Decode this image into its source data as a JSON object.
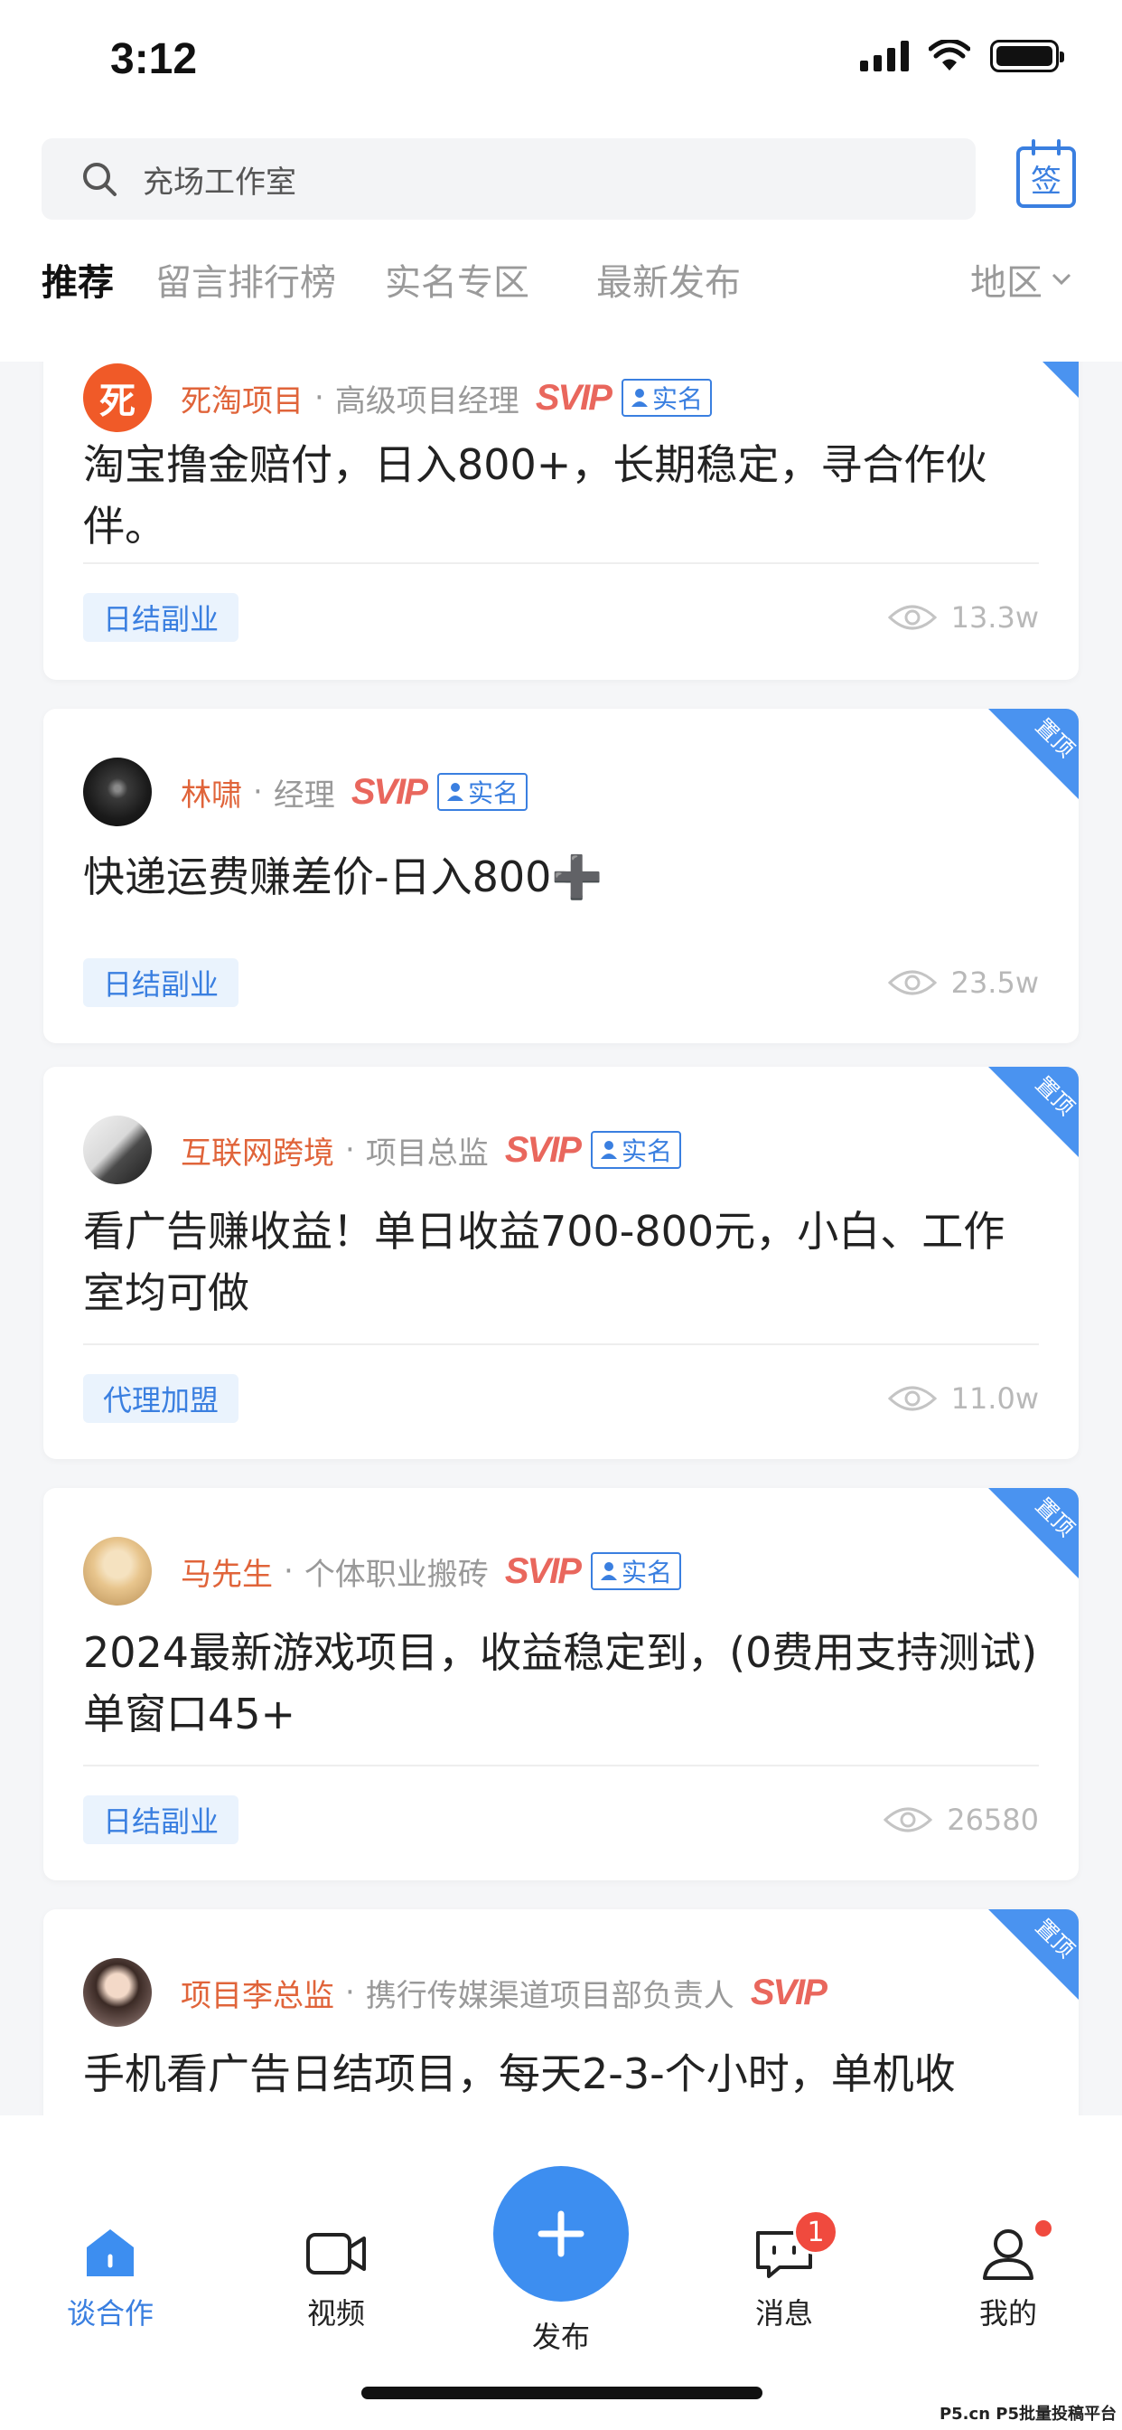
{
  "status_bar": {
    "time": "3:12"
  },
  "search": {
    "text": "充场工作室"
  },
  "checkin": {
    "label": "签"
  },
  "tabs": [
    {
      "label": "推荐",
      "active": true
    },
    {
      "label": "留言排行榜",
      "active": false
    },
    {
      "label": "实名专区",
      "active": false
    },
    {
      "label": "最新发布",
      "active": false
    }
  ],
  "region": {
    "label": "地区"
  },
  "svip_label": "SVIP",
  "verified_label": "实名",
  "pin_label": "置顶",
  "posts": [
    {
      "author": "死淘项目",
      "role": "高级项目经理",
      "svip": true,
      "verified": true,
      "pinned": true,
      "title": "淘宝撸金赔付，日入800+，长期稳定，寻合作伙伴。",
      "tag": "日结副业",
      "views": "13.3w",
      "avatar_label": "死"
    },
    {
      "author": "林啸",
      "role": "经理",
      "svip": true,
      "verified": true,
      "pinned": true,
      "title": "快递运费赚差价-日入800➕",
      "tag": "日结副业",
      "views": "23.5w"
    },
    {
      "author": "互联网跨境",
      "role": "项目总监",
      "svip": true,
      "verified": true,
      "pinned": true,
      "title": "看广告赚收益！单日收益700-800元，小白、工作室均可做",
      "tag": "代理加盟",
      "views": "11.0w"
    },
    {
      "author": "马先生",
      "role": "个体职业搬砖",
      "svip": true,
      "verified": true,
      "pinned": true,
      "title": "2024最新游戏项目，收益稳定到，(0费用支持测试)单窗口45+",
      "tag": "日结副业",
      "views": "26580"
    },
    {
      "author": "项目李总监",
      "role": "携行传媒渠道项目部负责人",
      "svip": true,
      "verified": false,
      "pinned": true,
      "title": "手机看广告日结项目，每天2-3-个小时，单机收",
      "tag": "",
      "views": ""
    }
  ],
  "bottom_nav": {
    "items": [
      {
        "label": "谈合作",
        "active": true
      },
      {
        "label": "视频",
        "active": false
      },
      {
        "label": "发布",
        "active": false
      },
      {
        "label": "消息",
        "active": false,
        "badge": "1"
      },
      {
        "label": "我的",
        "active": false
      }
    ]
  },
  "watermark": "P5.cn P5批量投稿平台",
  "colors": {
    "accent": "#3a7fe0",
    "author": "#e0643a",
    "svip": "#e9675d",
    "badge": "#f04a3e"
  }
}
